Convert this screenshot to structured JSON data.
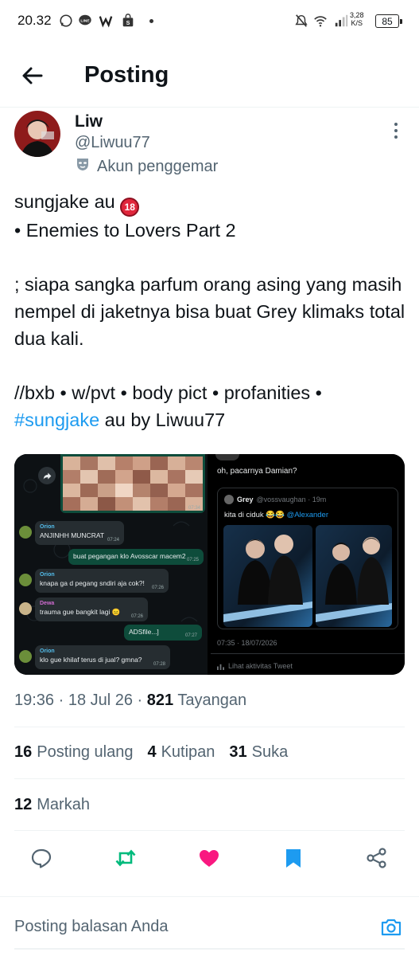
{
  "status_bar": {
    "time": "20.32",
    "net_speed_top": "3,28",
    "net_speed_unit": "K/S",
    "battery": "85"
  },
  "header": {
    "title": "Posting"
  },
  "author": {
    "name": "Liw",
    "handle": "@Liwuu77",
    "label": "Akun penggemar"
  },
  "tweet": {
    "line1": "sungjake au",
    "badge": "18",
    "line2": "• Enemies to Lovers Part 2",
    "para2": "; siapa sangka parfum orang asing yang masih nempel di jaketnya bisa buat Grey klimaks total dua kali.",
    "para3": "//bxb • w/pvt • body pict • profanities •",
    "hashtag": "#sungjake",
    "para3_end": " au by Liwuu77"
  },
  "media": {
    "left": {
      "img_time": "07:34",
      "messages": [
        {
          "name": "Orion",
          "text": "ANJINHH MUNCRAT",
          "time": "07:24"
        },
        {
          "name": "",
          "text": "buat pegangan klo Avosscar macem2",
          "time": "07:25"
        },
        {
          "name": "Orion",
          "text": "knapa ga d pegang sndiri aja cok?!",
          "time": "07:26"
        },
        {
          "name": "Dewa",
          "text": "trauma gue bangkit lagi 😑",
          "time": "07:26"
        },
        {
          "name": "",
          "text": "ADSfile...]",
          "time": "07:27"
        },
        {
          "name": "Orion",
          "text": "klo gue khilaf terus di jual? gmna?",
          "time": "07:28"
        }
      ]
    },
    "right": {
      "top_text": "oh, pacarnya Damian?",
      "quote_name": "Grey",
      "quote_handle": "@vossvaughan · 19m",
      "quote_text": "kita di ciduk 😂😂",
      "quote_mention": "@Alexander",
      "timestamp": "07:35 · 18/07/2026",
      "activity": "Lihat aktivitas Tweet"
    }
  },
  "meta": {
    "time_date": "19:36 · 18 Jul 26 ·",
    "views": "821",
    "views_label": "Tayangan"
  },
  "stats": {
    "reposts": "16",
    "reposts_label": "Posting ulang",
    "quotes": "4",
    "quotes_label": "Kutipan",
    "likes": "31",
    "likes_label": "Suka",
    "bookmarks": "12",
    "bookmarks_label": "Markah"
  },
  "reply": {
    "placeholder": "Posting balasan Anda"
  },
  "colors": {
    "accent": "#1d9bf0",
    "retweet": "#00ba7c",
    "like": "#f91880",
    "text": "#0f1419",
    "muted": "#536471"
  }
}
